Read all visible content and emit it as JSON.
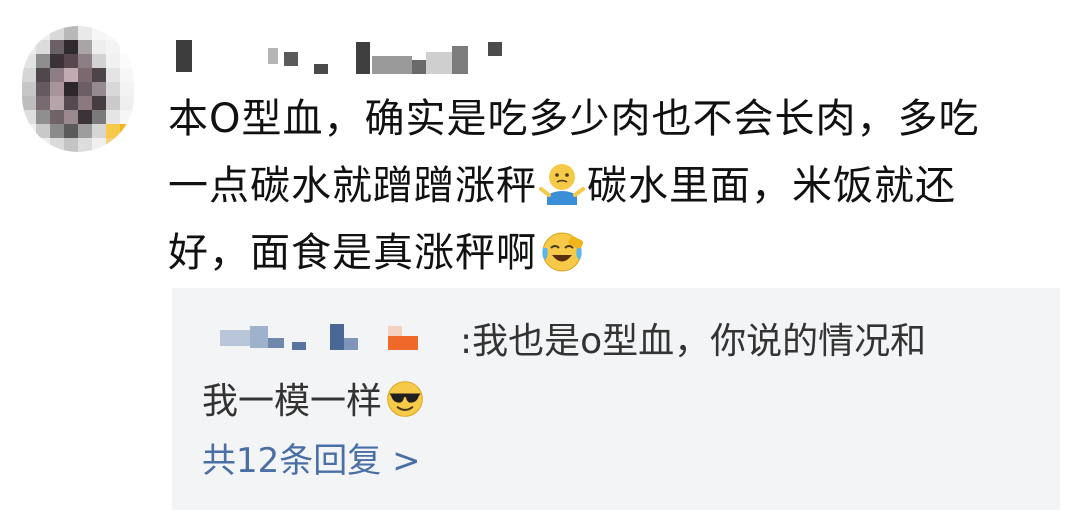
{
  "comment": {
    "line1": "本O型血，确实是吃多少肉也不会长肉，多吃",
    "line2_a": "一点碳水就蹭蹭涨秤",
    "line2_emoji": "shrug-emoji",
    "line2_b": "碳水里面，米饭就还",
    "line3_a": "好，面食是真涨秤啊",
    "line3_emoji": "laughing-crying-emoji"
  },
  "reply": {
    "line1": ":我也是o型血，你说的情况和",
    "line2": "我一模一样",
    "line2_emoji": "sunglasses-emoji",
    "more_label": "共12条回复 >"
  },
  "colors": {
    "text": "#111111",
    "reply_text": "#333333",
    "link": "#4a6fa5",
    "reply_bg": "#f3f4f6"
  }
}
